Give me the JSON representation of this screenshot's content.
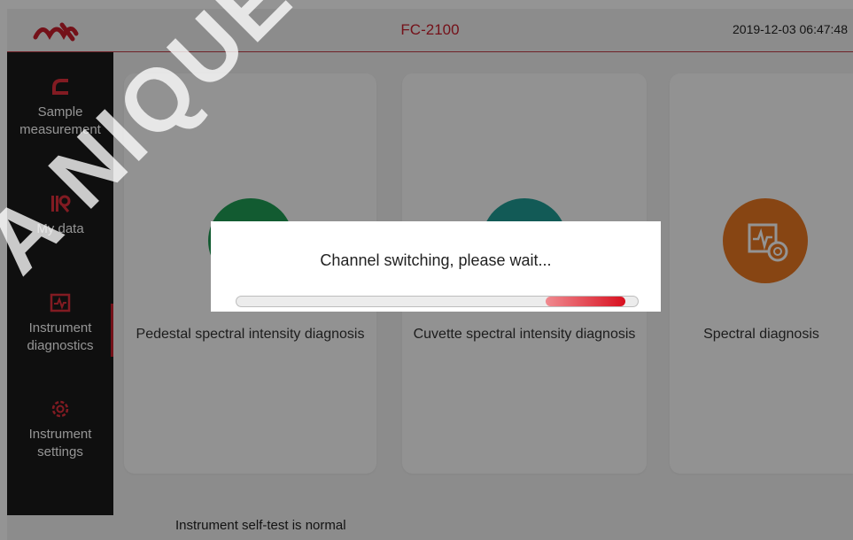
{
  "header": {
    "title": "FC-2100",
    "datetime": "2019-12-03 06:47:48"
  },
  "sidebar": {
    "items": [
      {
        "label_line1": "Sample",
        "label_line2": "measurement",
        "icon": "sample-icon"
      },
      {
        "label_line1": "My data",
        "label_line2": "",
        "icon": "data-icon"
      },
      {
        "label_line1": "Instrument",
        "label_line2": "diagnostics",
        "icon": "diagnostics-icon"
      },
      {
        "label_line1": "Instrument",
        "label_line2": "settings",
        "icon": "gear-icon"
      }
    ],
    "active_index": 2
  },
  "cards": [
    {
      "label": "Pedestal spectral intensity diagnosis",
      "color": "#1f9d55"
    },
    {
      "label": "Cuvette spectral intensity diagnosis",
      "color": "#1f9c94"
    },
    {
      "label": "Spectral diagnosis",
      "color": "#e87722"
    }
  ],
  "status_text": "Instrument self-test is normal",
  "dialog": {
    "message": "Channel switching, please wait...",
    "progress_segment_start": 0.77,
    "progress_segment_end": 0.97
  },
  "watermark": "A NIQUE DUT",
  "colors": {
    "accent": "#c81e2c",
    "sidebar_bg": "#1b1b1b"
  }
}
